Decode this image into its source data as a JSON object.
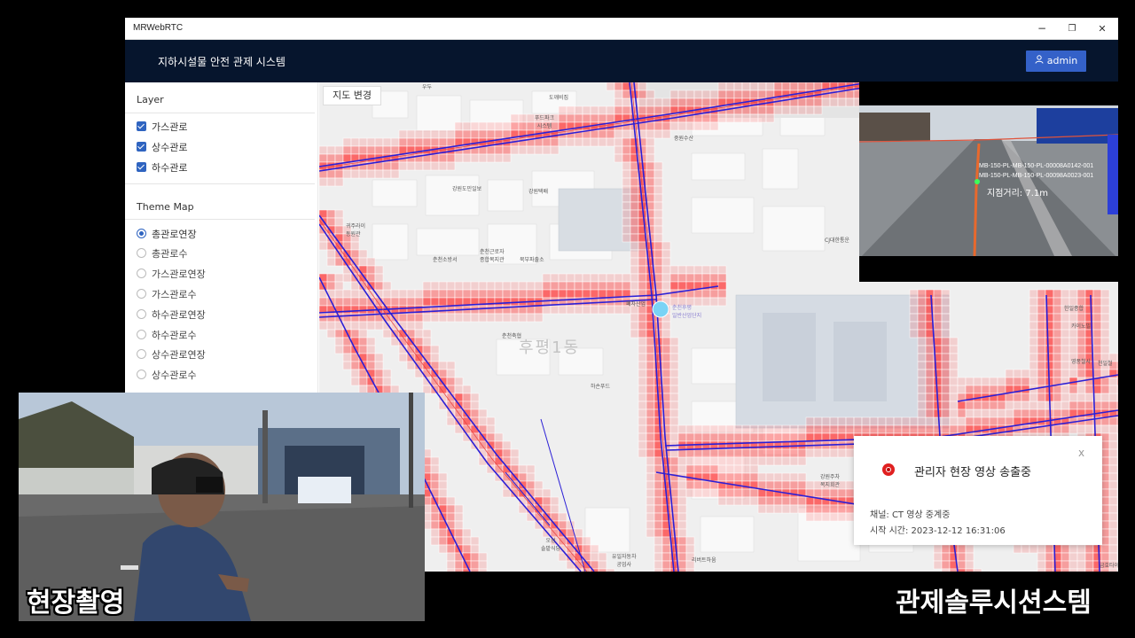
{
  "window": {
    "title": "MRWebRTC",
    "minimize_glyph": "−",
    "maximize_glyph": "❐",
    "close_glyph": "✕"
  },
  "header": {
    "app_title": "지하시설물 안전 관제 시스템",
    "user_button": "admin",
    "user_icon": "user-icon",
    "bg_color": "#06152d",
    "button_color": "#3461c8"
  },
  "sidebar": {
    "layer_title": "Layer",
    "layers": [
      {
        "label": "가스관로",
        "checked": true
      },
      {
        "label": "상수관로",
        "checked": true
      },
      {
        "label": "하수관로",
        "checked": true
      }
    ],
    "theme_title": "Theme Map",
    "themes": [
      {
        "label": "총관로연장",
        "selected": true
      },
      {
        "label": "총관로수",
        "selected": false
      },
      {
        "label": "가스관로연장",
        "selected": false
      },
      {
        "label": "가스관로수",
        "selected": false
      },
      {
        "label": "하수관로연장",
        "selected": false
      },
      {
        "label": "하수관로수",
        "selected": false
      },
      {
        "label": "상수관로연장",
        "selected": false
      },
      {
        "label": "상수관로수",
        "selected": false
      }
    ]
  },
  "map": {
    "change_button": "지도 변경",
    "dong_label": "후평1동",
    "pipe_color": "#2b1fd6",
    "heat_color": "#ff3b3b",
    "labels": [
      "우두",
      "도깨비집",
      "푸드파크\n시스템",
      "중원수산",
      "강원도민일보",
      "강원택배",
      "춘천소방서",
      "춘천근로자\n종합복지관",
      "북부파출소",
      "귀주라이\n동원관",
      "CJ대한통운",
      "폐차산업",
      "춘천후평\n일반산업단지",
      "춘천축협",
      "하손푸드",
      "한일종합",
      "카이노빌",
      "영풍철사",
      "천일철",
      "강원주차\n복지회관",
      "오성\n솔밭식당",
      "유일자동차\n공업사",
      "리버트하움",
      "금호타이"
    ]
  },
  "camera_feed": {
    "overlay_lines": [
      "MB-150-PL-MB-150-PL-00008A0142-001",
      "MB-150-PL-MB-150-PL-00098A0023-001"
    ],
    "distance": "지점거리: 7.1m"
  },
  "notification": {
    "title": "관리자 현장 영상 송출중",
    "channel": "채널: CT 영상 중계중",
    "start_time": "시작 시간: 2023-12-12 16:31:06",
    "close_glyph": "x",
    "status_color": "#e02020"
  },
  "captions": {
    "left": "현장촬영",
    "right": "관제솔루시션스템"
  }
}
